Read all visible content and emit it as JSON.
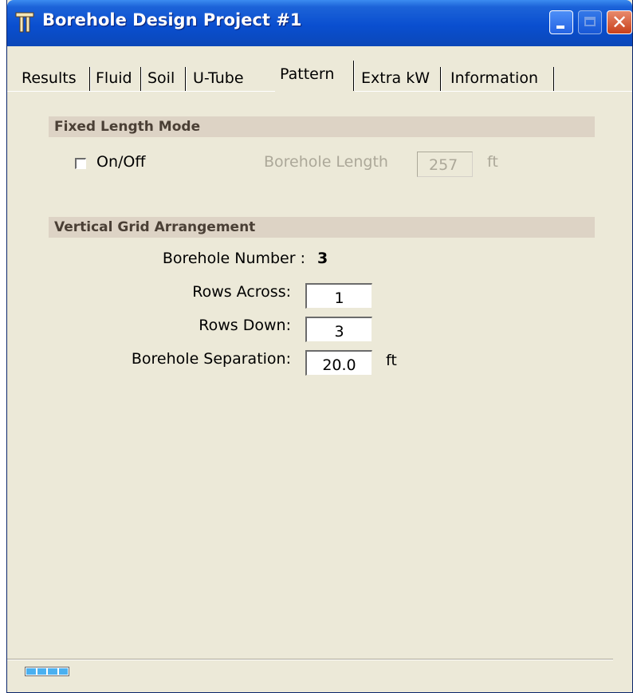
{
  "window": {
    "title": "Borehole Design Project #1",
    "close_glyph": "✕"
  },
  "tabs": [
    {
      "label": "Results"
    },
    {
      "label": "Fluid"
    },
    {
      "label": "Soil"
    },
    {
      "label": "U-Tube"
    },
    {
      "label": "Pattern",
      "active": true
    },
    {
      "label": "Extra kW"
    },
    {
      "label": "Information"
    }
  ],
  "fixed_length_mode": {
    "heading": "Fixed Length Mode",
    "checkbox_label": "On/Off",
    "checkbox_checked": false,
    "borehole_length_label": "Borehole Length",
    "borehole_length_value": "257",
    "unit": "ft"
  },
  "vertical_grid": {
    "heading": "Vertical Grid Arrangement",
    "borehole_number_label": "Borehole Number :",
    "borehole_number_value": "3",
    "rows_across_label": "Rows Across:",
    "rows_across_value": "1",
    "rows_down_label": "Rows Down:",
    "rows_down_value": "3",
    "separation_label": "Borehole Separation:",
    "separation_value": "20.0",
    "separation_unit": "ft"
  },
  "status": {
    "progress_icon": "progress-indicator-icon"
  }
}
